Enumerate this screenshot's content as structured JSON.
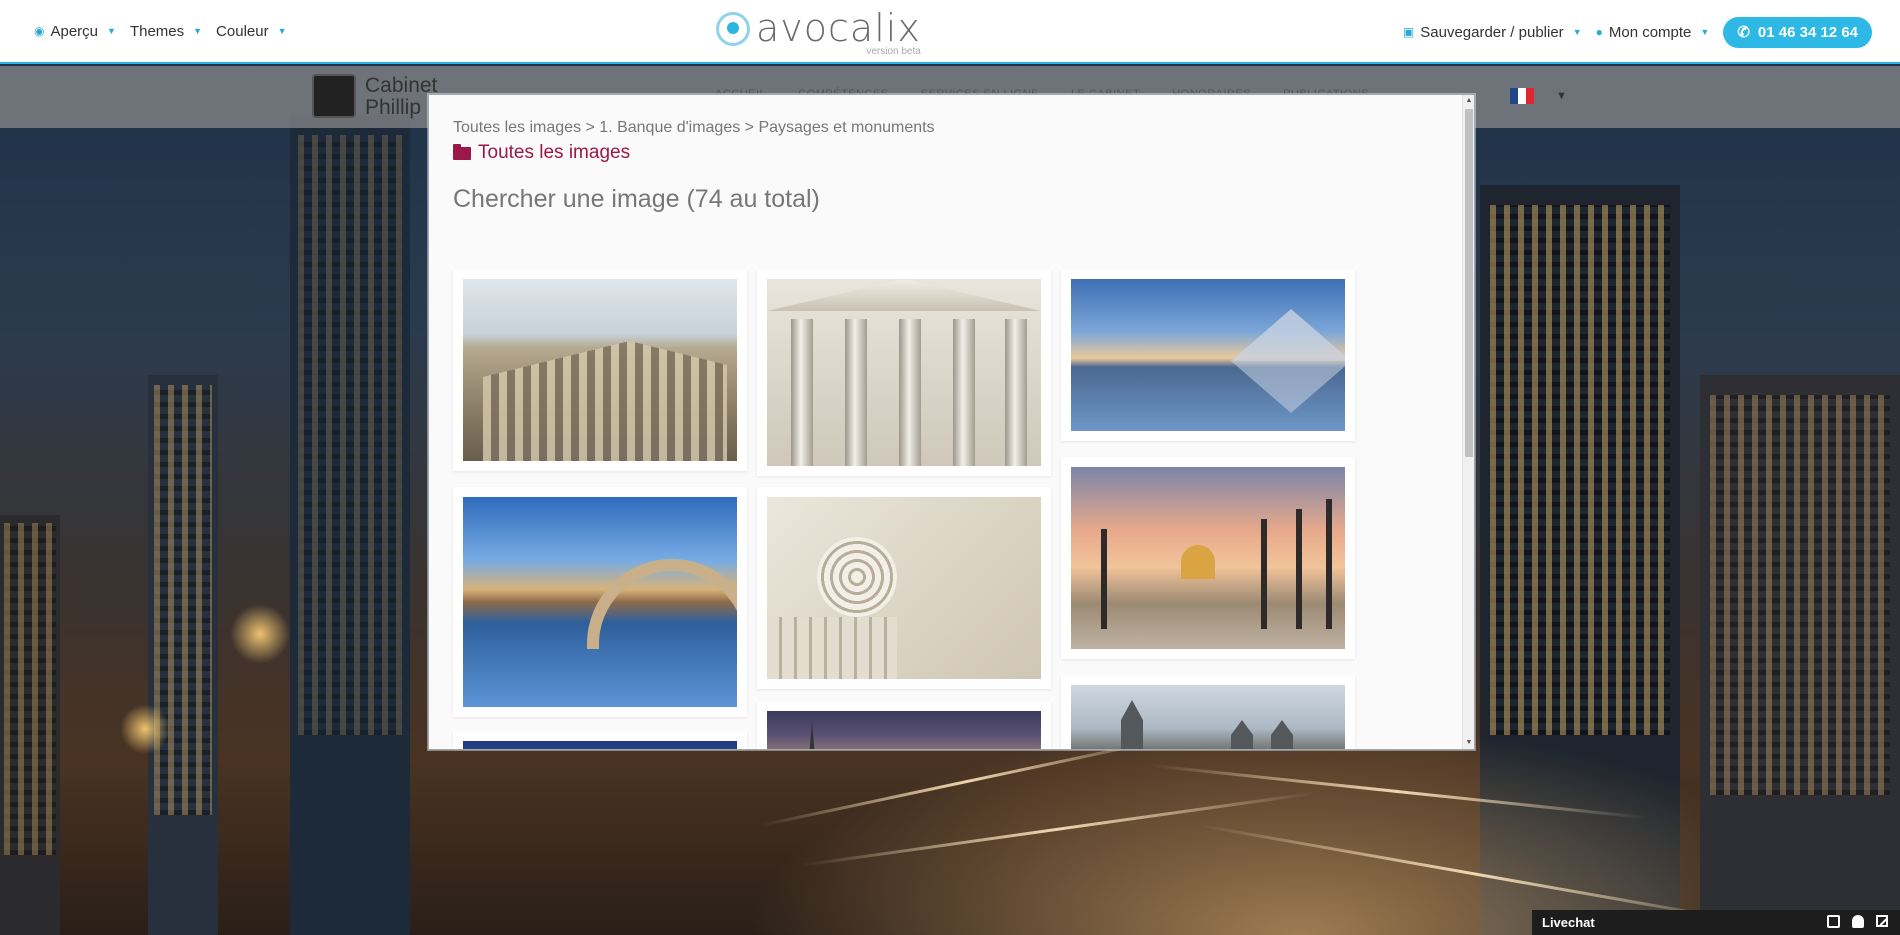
{
  "topbar": {
    "apercu": "Aperçu",
    "themes": "Themes",
    "couleur": "Couleur",
    "logo": "avocalix",
    "logo_sub": "version beta",
    "save": "Sauvegarder / publier",
    "account": "Mon compte",
    "phone": "01 46 34 12 64",
    "accent_color": "#29b6e0"
  },
  "site": {
    "name_line1": "Cabinet",
    "name_line2": "Phillip",
    "nav": [
      "ACCUEIL",
      "COMPÉTENCES",
      "SERVICES EN LIGNE",
      "LE CABINET",
      "HONORAIRES",
      "PUBLICATIONS"
    ],
    "language": "FR"
  },
  "modal": {
    "breadcrumb": "Toutes les images > 1. Banque d'images > Paysages et monuments",
    "folder_label": "Toutes les images",
    "heading": "Chercher une image (74 au total)",
    "folder_color": "#9c1848"
  },
  "livechat": {
    "label": "Livechat"
  }
}
